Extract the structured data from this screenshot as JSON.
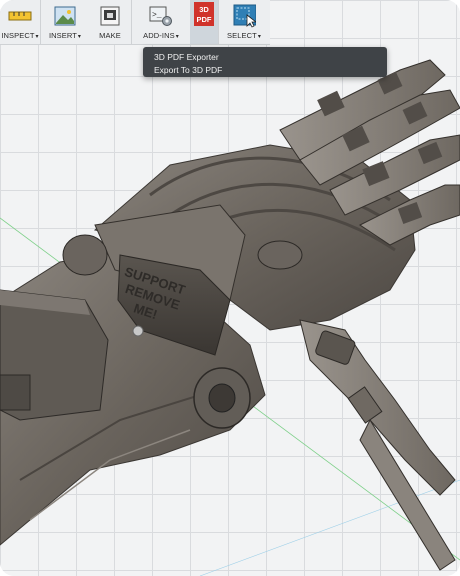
{
  "toolbar": {
    "items": [
      {
        "label": "INSPECT",
        "icon": "ruler-icon",
        "has_caret": true
      },
      {
        "label": "INSERT",
        "icon": "image-insert-icon",
        "has_caret": true
      },
      {
        "label": "MAKE",
        "icon": "print-3d-icon",
        "has_caret": false
      },
      {
        "label": "ADD-INS",
        "icon": "script-addin-icon",
        "has_caret": true
      },
      {
        "label": "",
        "icon": "pdf-3d-icon",
        "has_caret": false
      },
      {
        "label": "SELECT",
        "icon": "cursor-select-icon",
        "has_caret": true
      }
    ],
    "caret": "▾",
    "pdf_badge_top": "3D",
    "pdf_badge_bottom": "PDF"
  },
  "dropdown": {
    "title": "3D PDF Exporter",
    "items": [
      "Export To 3D PDF"
    ]
  },
  "model": {
    "emboss_text": [
      "SUPPORT",
      "REMOVE",
      "ME!"
    ]
  },
  "colors": {
    "toolbar_bg": "#eceef0",
    "menu_bg": "#3f4347",
    "model_base": "#6d6760",
    "pdf_red": "#d0332b",
    "select_blue": "#2f7fb5"
  }
}
